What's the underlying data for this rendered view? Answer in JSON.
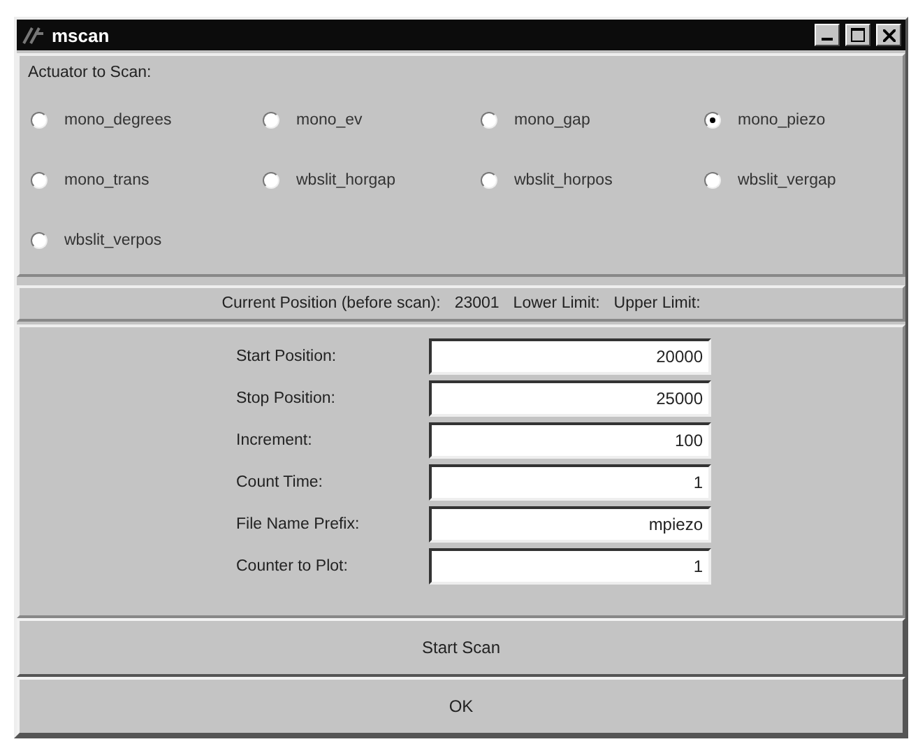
{
  "window": {
    "title": "mscan"
  },
  "actuator": {
    "label": "Actuator to Scan:",
    "options": [
      {
        "label": "mono_degrees",
        "selected": false
      },
      {
        "label": "mono_ev",
        "selected": false
      },
      {
        "label": "mono_gap",
        "selected": false
      },
      {
        "label": "mono_piezo",
        "selected": true
      },
      {
        "label": "mono_trans",
        "selected": false
      },
      {
        "label": "wbslit_horgap",
        "selected": false
      },
      {
        "label": "wbslit_horpos",
        "selected": false
      },
      {
        "label": "wbslit_vergap",
        "selected": false
      },
      {
        "label": "wbslit_verpos",
        "selected": false
      }
    ]
  },
  "status": {
    "current_label": "Current Position (before scan):",
    "current_value": "23001",
    "lower_label": "Lower Limit:",
    "upper_label": "Upper Limit:"
  },
  "fields": [
    {
      "label": "Start Position:",
      "value": "20000"
    },
    {
      "label": "Stop Position:",
      "value": "25000"
    },
    {
      "label": "Increment:",
      "value": "100"
    },
    {
      "label": "Count Time:",
      "value": "1"
    },
    {
      "label": "File Name Prefix:",
      "value": "mpiezo"
    },
    {
      "label": "Counter to Plot:",
      "value": "1"
    }
  ],
  "buttons": [
    "Start Scan",
    "OK"
  ]
}
